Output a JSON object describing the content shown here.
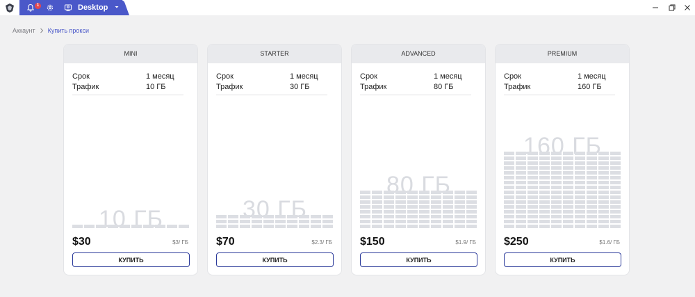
{
  "window": {
    "tab_label": "Desktop",
    "notification_count": "1"
  },
  "breadcrumb": {
    "root": "Аккаунт",
    "current": "Купить прокси"
  },
  "labels": {
    "term": "Срок",
    "traffic": "Трафик",
    "buy": "КУПИТЬ"
  },
  "plans": [
    {
      "name": "MINI",
      "term": "1 месяц",
      "traffic": "10 ГБ",
      "viz_label": "10 ГБ",
      "price": "$30",
      "per_gb": "$3/ ГБ",
      "grid_rows": 1
    },
    {
      "name": "STARTER",
      "term": "1 месяц",
      "traffic": "30 ГБ",
      "viz_label": "30 ГБ",
      "price": "$70",
      "per_gb": "$2.3/ ГБ",
      "grid_rows": 3
    },
    {
      "name": "ADVANCED",
      "term": "1 месяц",
      "traffic": "80 ГБ",
      "viz_label": "80 ГБ",
      "price": "$150",
      "per_gb": "$1.9/ ГБ",
      "grid_rows": 8
    },
    {
      "name": "PREMIUM",
      "term": "1 месяц",
      "traffic": "160 ГБ",
      "viz_label": "160 ГБ",
      "price": "$250",
      "per_gb": "$1.6/ ГБ",
      "grid_rows": 16
    }
  ],
  "colors": {
    "accent": "#4a58c9",
    "button_border": "#2b3a9a",
    "cell": "#dcdee3"
  },
  "icons": [
    "app-logo-icon",
    "bell-icon",
    "gear-icon",
    "desktop-icon",
    "chevron-down-icon",
    "minimize-icon",
    "restore-icon",
    "close-icon",
    "chevron-right-icon"
  ]
}
